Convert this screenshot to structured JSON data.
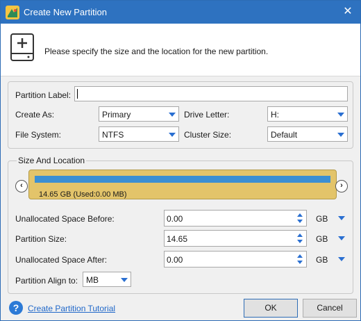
{
  "window": {
    "title": "Create New Partition",
    "close_glyph": "✕"
  },
  "header": {
    "instruction": "Please specify the size and the location for the new partition.",
    "icon": "disk-add-icon"
  },
  "properties": {
    "partition_label_label": "Partition Label:",
    "partition_label_value": "",
    "create_as_label": "Create As:",
    "create_as_value": "Primary",
    "drive_letter_label": "Drive Letter:",
    "drive_letter_value": "H:",
    "file_system_label": "File System:",
    "file_system_value": "NTFS",
    "cluster_size_label": "Cluster Size:",
    "cluster_size_value": "Default"
  },
  "size_location": {
    "legend": "Size And Location",
    "left_nav": "‹",
    "right_nav": "›",
    "partition_bar_text": "14.65 GB (Used:0.00 MB)",
    "used_fraction": 0.0,
    "unallocated_before_label": "Unallocated Space Before:",
    "unallocated_before_value": "0.00",
    "unallocated_before_unit": "GB",
    "partition_size_label": "Partition Size:",
    "partition_size_value": "14.65",
    "partition_size_unit": "GB",
    "unallocated_after_label": "Unallocated Space After:",
    "unallocated_after_value": "0.00",
    "unallocated_after_unit": "GB",
    "align_label": "Partition Align to:",
    "align_value": "MB"
  },
  "footer": {
    "help_glyph": "?",
    "tutorial_link": "Create Partition Tutorial",
    "ok_label": "OK",
    "cancel_label": "Cancel"
  },
  "colors": {
    "titlebar": "#2e72c0",
    "partition_fill": "#e3c46a",
    "used_bar": "#3b8fd3",
    "accent": "#2a6fd1"
  }
}
